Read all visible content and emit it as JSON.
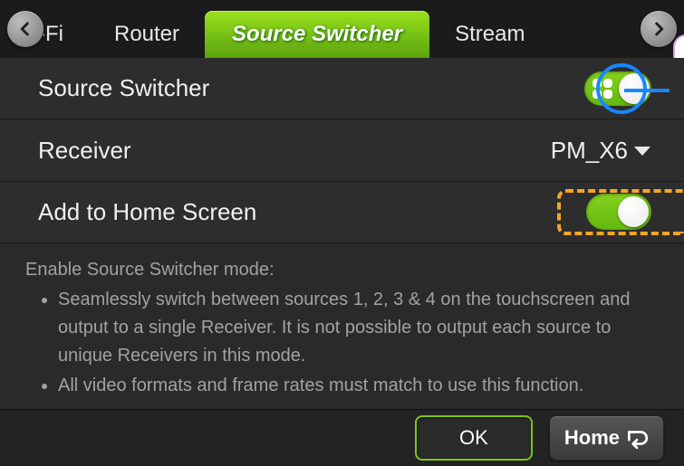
{
  "tabs": {
    "prev_partial": "-Fi",
    "items": [
      "Router",
      "Source Switcher",
      "Stream"
    ],
    "active_index": 1
  },
  "rows": {
    "source_switcher": {
      "label": "Source Switcher",
      "toggle_on": true
    },
    "receiver": {
      "label": "Receiver",
      "value": "PM_X6"
    },
    "add_home": {
      "label": "Add to Home Screen",
      "toggle_on": true
    }
  },
  "info": {
    "lead": "Enable Source Switcher mode:",
    "bullets": [
      "Seamlessly switch between sources 1, 2, 3 & 4 on the touchscreen and output to a single Receiver.  It is not possible to output each source to unique Receivers in this mode.",
      "All video formats and frame rates must match to use this function."
    ]
  },
  "buttons": {
    "ok": "OK",
    "home": "Home"
  },
  "colors": {
    "accent": "#7cc516",
    "focus": "#f5a623",
    "highlight": "#1787ff"
  }
}
